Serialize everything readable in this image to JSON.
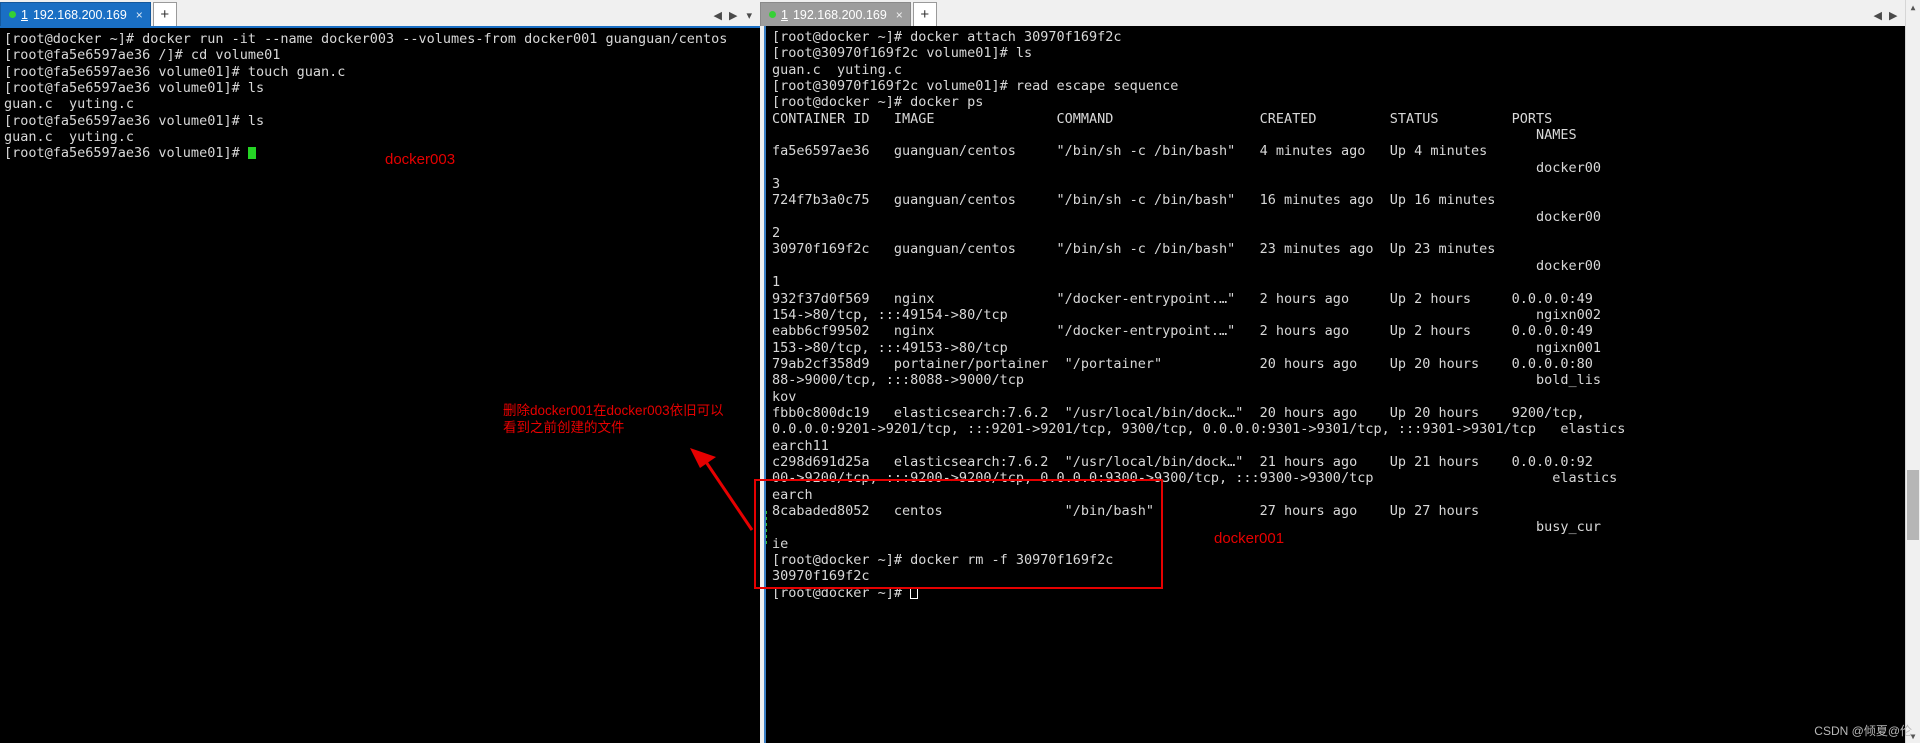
{
  "left_pane": {
    "tab": {
      "index": "1",
      "title": "192.168.200.169",
      "close_label": "×",
      "status_dot_color": "#35d135"
    },
    "new_tab_label": "+",
    "nav": {
      "prev": "◀",
      "next": "▶",
      "menu": "▾"
    },
    "terminal_lines": [
      "[root@docker ~]# docker run -it --name docker003 --volumes-from docker001 guanguan/centos",
      "[root@fa5e6597ae36 /]# cd volume01",
      "[root@fa5e6597ae36 volume01]# touch guan.c",
      "[root@fa5e6597ae36 volume01]# ls",
      "guan.c  yuting.c",
      "[root@fa5e6597ae36 volume01]# ls",
      "guan.c  yuting.c",
      "[root@fa5e6597ae36 volume01]# "
    ],
    "annotation_label": "docker003",
    "annotation_note_lines": [
      "删除docker001在docker003依旧可以",
      "看到之前创建的文件"
    ]
  },
  "right_pane": {
    "tab": {
      "index": "1",
      "title": "192.168.200.169",
      "close_label": "×",
      "status_dot_color": "#35d135"
    },
    "new_tab_label": "+",
    "nav": {
      "prev": "◀",
      "next": "▶",
      "menu": "▾"
    },
    "terminal_lines": [
      "[root@docker ~]# docker attach 30970f169f2c",
      "[root@30970f169f2c volume01]# ls",
      "guan.c  yuting.c",
      "[root@30970f169f2c volume01]# read escape sequence",
      "[root@docker ~]# docker ps",
      "CONTAINER ID   IMAGE               COMMAND                  CREATED         STATUS         PORTS",
      "                                                                                              NAMES",
      "fa5e6597ae36   guanguan/centos     \"/bin/sh -c /bin/bash\"   4 minutes ago   Up 4 minutes",
      "                                                                                              docker00",
      "3",
      "724f7b3a0c75   guanguan/centos     \"/bin/sh -c /bin/bash\"   16 minutes ago  Up 16 minutes",
      "                                                                                              docker00",
      "2",
      "30970f169f2c   guanguan/centos     \"/bin/sh -c /bin/bash\"   23 minutes ago  Up 23 minutes",
      "                                                                                              docker00",
      "1",
      "932f37d0f569   nginx               \"/docker-entrypoint.…\"   2 hours ago     Up 2 hours     0.0.0.0:49",
      "154->80/tcp, :::49154->80/tcp                                                                 ngixn002",
      "eabb6cf99502   nginx               \"/docker-entrypoint.…\"   2 hours ago     Up 2 hours     0.0.0.0:49",
      "153->80/tcp, :::49153->80/tcp                                                                 ngixn001",
      "79ab2cf358d9   portainer/portainer  \"/portainer\"            20 hours ago    Up 20 hours    0.0.0.0:80",
      "88->9000/tcp, :::8088->9000/tcp                                                               bold_lis",
      "kov",
      "fbb0c800dc19   elasticsearch:7.6.2  \"/usr/local/bin/dock…\"  20 hours ago    Up 20 hours    9200/tcp,",
      "0.0.0.0:9201->9201/tcp, :::9201->9201/tcp, 9300/tcp, 0.0.0.0:9301->9301/tcp, :::9301->9301/tcp   elastics",
      "earch11",
      "c298d691d25a   elasticsearch:7.6.2  \"/usr/local/bin/dock…\"  21 hours ago    Up 21 hours    0.0.0.0:92",
      "00->9200/tcp, :::9200->9200/tcp, 0.0.0.0:9300->9300/tcp, :::9300->9300/tcp                      elastics",
      "earch",
      "8cabaded8052   centos               \"/bin/bash\"             27 hours ago    Up 27 hours",
      "                                                                                              busy_cur",
      "ie",
      "[root@docker ~]# docker rm -f 30970f169f2c",
      "30970f169f2c",
      "[root@docker ~]# "
    ],
    "annotation_label": "docker001"
  },
  "watermark": "CSDN @倾夏@伦"
}
